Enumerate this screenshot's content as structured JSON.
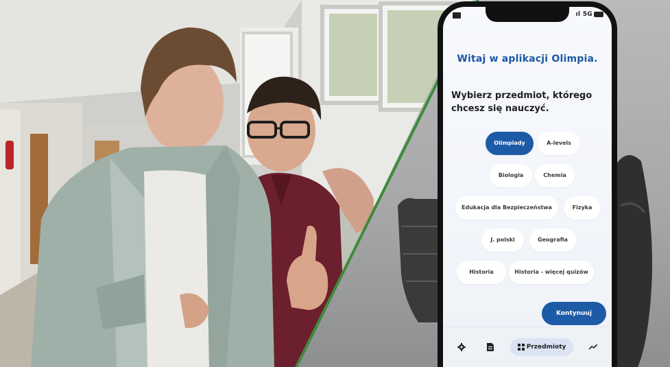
{
  "app": {
    "welcome": "Witaj w aplikacji Olimpia.",
    "prompt": "Wybierz przedmiot, którego chcesz się nauczyć.",
    "status": {
      "signal_text": "ıl 5G"
    },
    "subjects": [
      {
        "label": "Olimpiady",
        "selected": true
      },
      {
        "label": "A-levels",
        "selected": false
      },
      {
        "label": "Biologia",
        "selected": false
      },
      {
        "label": "Chemia",
        "selected": false
      },
      {
        "label": "Edukacja dla Bezpieczeństwa",
        "selected": false
      },
      {
        "label": "Fizyka",
        "selected": false
      },
      {
        "label": "J. polski",
        "selected": false
      },
      {
        "label": "Geografia",
        "selected": false
      },
      {
        "label": "Historia",
        "selected": false
      },
      {
        "label": "Historia - więcej quizów",
        "selected": false
      }
    ],
    "continue_label": "Kontynuuj",
    "nav": {
      "settings_icon": "gear-icon",
      "notes_icon": "document-icon",
      "subjects_label": "Przedmioty",
      "subjects_icon": "grid-icon",
      "stats_icon": "trend-icon"
    }
  },
  "colors": {
    "accent": "#1e5ba7",
    "divider": "#3f8a3a",
    "chip_bg": "#ffffff"
  }
}
